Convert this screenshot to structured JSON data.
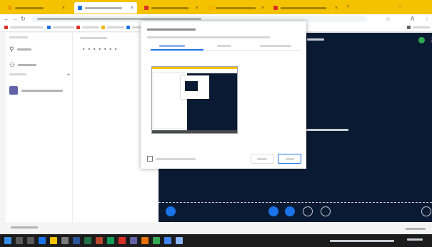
{
  "browser": {
    "tabs": [
      {
        "title": "",
        "favicon_color": "#f0a000",
        "active": false
      },
      {
        "title": "",
        "favicon_color": "#1a73e8",
        "active": true
      },
      {
        "title": "",
        "favicon_color": "#d93025",
        "active": false
      },
      {
        "title": "",
        "favicon_color": "#f4b400",
        "active": false
      },
      {
        "title": "",
        "favicon_color": "#d93025",
        "active": false
      }
    ],
    "address": "",
    "bookmarks": [
      {
        "label": "",
        "color": "#d93025"
      },
      {
        "label": "",
        "color": "#1a73e8"
      },
      {
        "label": "",
        "color": "#d93025"
      },
      {
        "label": "",
        "color": "#f4b400"
      },
      {
        "label": "",
        "color": "#1a73e8"
      },
      {
        "label": "",
        "color": "#5f6368"
      }
    ],
    "accent": "#f5c200"
  },
  "left_panel": {
    "header": "",
    "search_label": "",
    "section_label": "",
    "contact_name": "",
    "contact_detail": ""
  },
  "video": {
    "caption": "",
    "background": "#0b1a33"
  },
  "dialog": {
    "title": "",
    "subtitle": "",
    "tabs": [
      "",
      "",
      ""
    ],
    "checkbox_label": "",
    "cancel_label": "",
    "share_label": "",
    "accent": "#1a73e8"
  },
  "footer": {
    "left_label": "",
    "right_label": ""
  },
  "taskbar": {
    "clock": ""
  }
}
